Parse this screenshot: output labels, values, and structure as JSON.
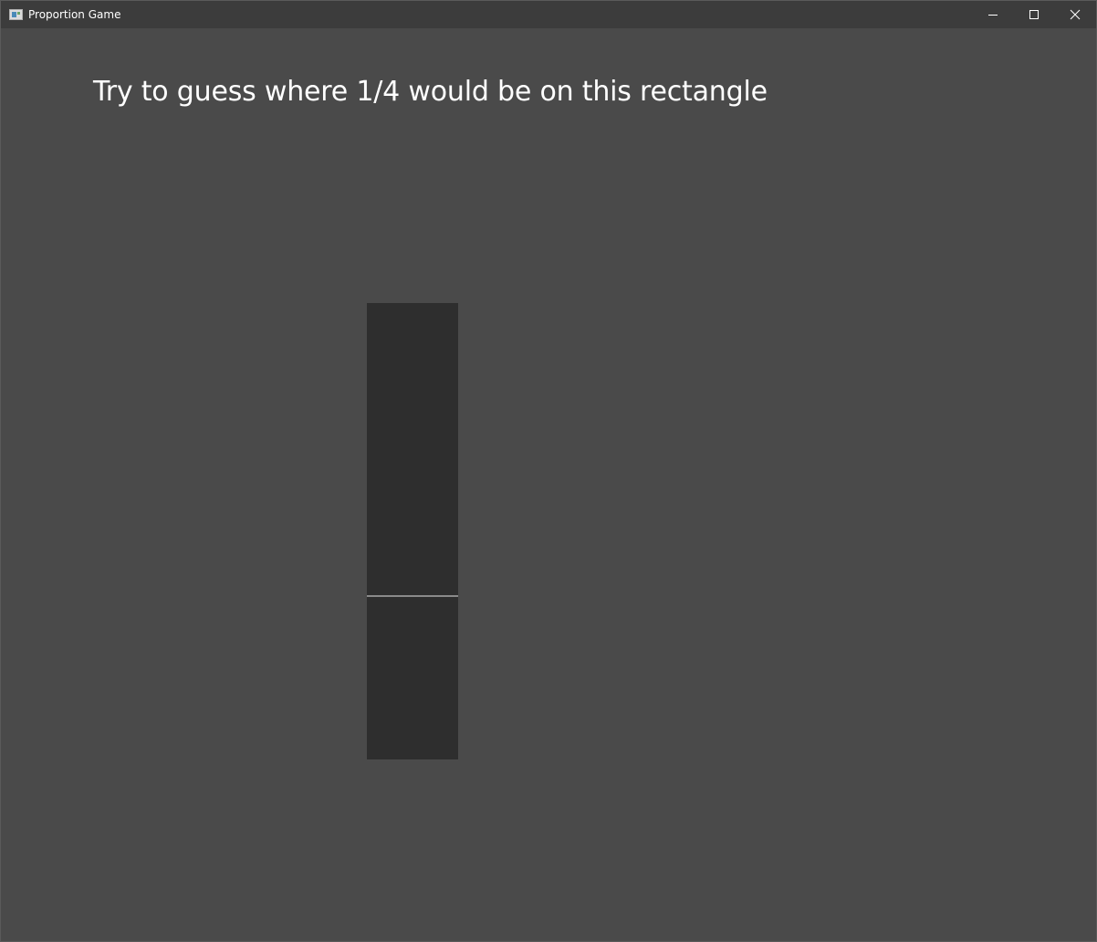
{
  "window": {
    "title": "Proportion Game",
    "icon": "app-window-icon",
    "controls": {
      "minimize_icon": "minimize-icon",
      "maximize_icon": "maximize-icon",
      "close_icon": "close-icon"
    }
  },
  "game": {
    "prompt": "Try to guess where 1/4 would be on this rectangle",
    "target_fraction": "1/4",
    "guess_line_fraction_from_bottom": 0.36
  },
  "colors": {
    "background": "#4a4a4a",
    "titlebar": "#3c3c3c",
    "rectangle": "#2e2e2e",
    "guess_line": "#8a8a8a",
    "text": "#ffffff"
  }
}
